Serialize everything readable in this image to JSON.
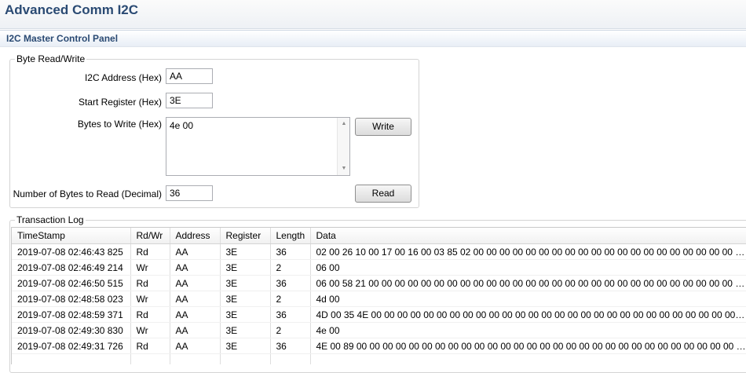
{
  "app": {
    "title": "Advanced Comm I2C"
  },
  "panel": {
    "title": "I2C Master Control Panel"
  },
  "byte_rw": {
    "legend": "Byte Read/Write",
    "address_label": "I2C Address (Hex)",
    "address_value": "AA",
    "start_register_label": "Start Register (Hex)",
    "start_register_value": "3E",
    "bytes_to_write_label": "Bytes to Write (Hex)",
    "bytes_to_write_value": "4e 00",
    "bytes_to_read_label": "Number of Bytes to Read (Decimal)",
    "bytes_to_read_value": "36",
    "write_button": "Write",
    "read_button": "Read"
  },
  "log": {
    "legend": "Transaction Log",
    "columns": [
      "TimeStamp",
      "Rd/Wr",
      "Address",
      "Register",
      "Length",
      "Data"
    ],
    "rows": [
      [
        "2019-07-08 02:46:43 825",
        "Rd",
        "AA",
        "3E",
        "36",
        "02 00 26 10 00 17 00 16 00 03 85 02 00 00 00 00 00 00 00 00 00 00 00 00 00 00 00 00 00 00 00 00 00 00 00 00 ..."
      ],
      [
        "2019-07-08 02:46:49 214",
        "Wr",
        "AA",
        "3E",
        "2",
        "06 00"
      ],
      [
        "2019-07-08 02:46:50 515",
        "Rd",
        "AA",
        "3E",
        "36",
        "06 00 58 21 00 00 00 00 00 00 00 00 00 00 00 00 00 00 00 00 00 00 00 00 00 00 00 00 00 00 00 00 00 00 00 00 ..."
      ],
      [
        "2019-07-08 02:48:58 023",
        "Wr",
        "AA",
        "3E",
        "2",
        "4d 00"
      ],
      [
        "2019-07-08 02:48:59 371",
        "Rd",
        "AA",
        "3E",
        "36",
        "4D 00 35 4E 00 00 00 00 00 00 00 00 00 00 00 00 00 00 00 00 00 00 00 00 00 00 00 00 00 00 00 00 00 00 00 00 ..."
      ],
      [
        "2019-07-08 02:49:30 830",
        "Wr",
        "AA",
        "3E",
        "2",
        "4e 00"
      ],
      [
        "2019-07-08 02:49:31 726",
        "Rd",
        "AA",
        "3E",
        "36",
        "4E 00 89 00 00 00 00 00 00 00 00 00 00 00 00 00 00 00 00 00 00 00 00 00 00 00 00 00 00 00 00 00 00 00 00 00 ..."
      ]
    ]
  },
  "icons": {
    "scroll_up": "scroll-up-arrow-icon",
    "scroll_down": "scroll-down-arrow-icon"
  },
  "colors": {
    "title_text": "#2a4a73",
    "border": "#d4d4d4"
  }
}
